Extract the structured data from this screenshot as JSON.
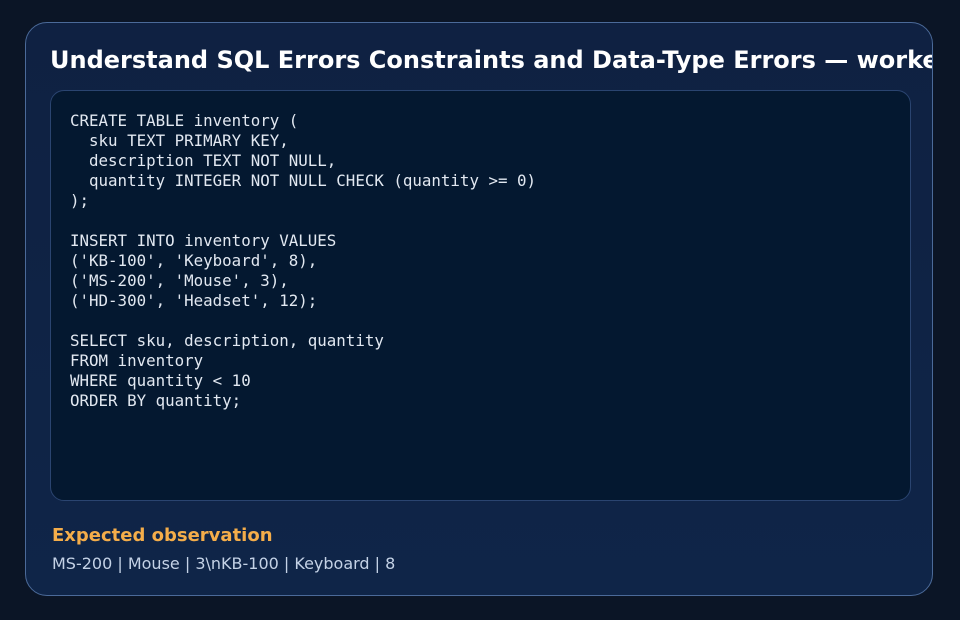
{
  "title": "Understand SQL Errors Constraints and Data-Type Errors — worked example",
  "code": "CREATE TABLE inventory (\n  sku TEXT PRIMARY KEY,\n  description TEXT NOT NULL,\n  quantity INTEGER NOT NULL CHECK (quantity >= 0)\n);\n\nINSERT INTO inventory VALUES\n('KB-100', 'Keyboard', 8),\n('MS-200', 'Mouse', 3),\n('HD-300', 'Headset', 12);\n\nSELECT sku, description, quantity\nFROM inventory\nWHERE quantity < 10\nORDER BY quantity;",
  "observation": {
    "heading": "Expected observation",
    "text": "MS-200 | Mouse | 3\\nKB-100 | Keyboard | 8"
  },
  "colors": {
    "page_background": "#0b1526",
    "card_background": "#0f2345",
    "card_border": "#4b6a99",
    "code_background": "#041830",
    "heading_accent": "#f4ad4a",
    "title_text": "#ffffff",
    "code_text": "#e2e8f1",
    "body_text": "#c4d2e6"
  }
}
